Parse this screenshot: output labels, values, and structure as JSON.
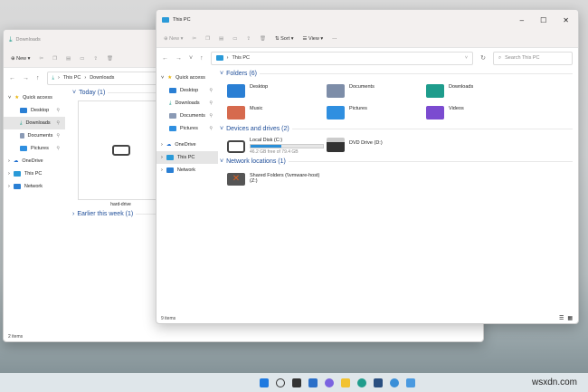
{
  "back_window": {
    "title": "Downloads",
    "toolbar": {
      "new": "New"
    },
    "breadcrumb": [
      "This PC",
      "Downloads"
    ],
    "nav": [
      {
        "label": "Quick access"
      },
      {
        "label": "Desktop"
      },
      {
        "label": "Downloads"
      },
      {
        "label": "Documents"
      },
      {
        "label": "Pictures"
      },
      {
        "label": "OneDrive"
      },
      {
        "label": "This PC"
      },
      {
        "label": "Network"
      }
    ],
    "groups": {
      "today": "Today (1)",
      "earlier": "Earlier this week (1)"
    },
    "file": "hard-drive",
    "status": "2 items"
  },
  "front_window": {
    "title": "This PC",
    "toolbar": {
      "new": "New",
      "sort": "Sort",
      "view": "View",
      "more": "···"
    },
    "breadcrumb": "This PC",
    "search_placeholder": "Search This PC",
    "nav": [
      {
        "label": "Quick access"
      },
      {
        "label": "Desktop"
      },
      {
        "label": "Downloads"
      },
      {
        "label": "Documents"
      },
      {
        "label": "Pictures"
      },
      {
        "label": "OneDrive"
      },
      {
        "label": "This PC"
      },
      {
        "label": "Network"
      }
    ],
    "sections": {
      "folders": "Folders (6)",
      "drives": "Devices and drives (2)",
      "network": "Network locations (1)"
    },
    "folders": [
      {
        "label": "Desktop",
        "color": "#2a7fd4"
      },
      {
        "label": "Documents",
        "color": "#7d8da8"
      },
      {
        "label": "Downloads",
        "color": "#1e9c8c"
      },
      {
        "label": "Music",
        "color": "#d66a4e"
      },
      {
        "label": "Pictures",
        "color": "#2f8fe0"
      },
      {
        "label": "Videos",
        "color": "#7b4bd0"
      }
    ],
    "drives": [
      {
        "label": "Local Disk (C:)",
        "free": "46.2 GB free of 79.4 GB",
        "used_fraction": 0.42
      },
      {
        "label": "DVD Drive (D:)"
      }
    ],
    "network_location": {
      "line1": "Shared Folders (\\\\vmware-host)",
      "line2": "(Z:)"
    },
    "status": "9 items"
  },
  "watermark": "wsxdn.com"
}
